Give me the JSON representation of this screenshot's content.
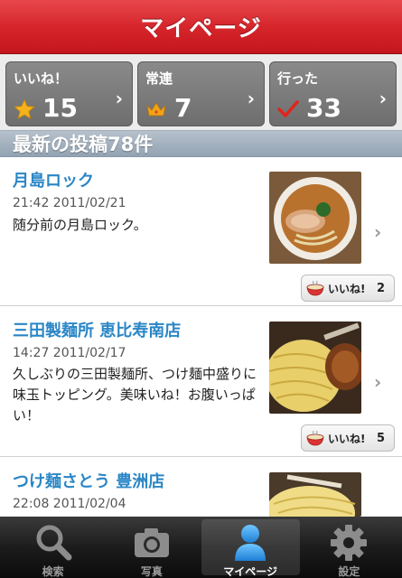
{
  "header": {
    "title": "マイページ"
  },
  "stats": [
    {
      "label": "いいね！",
      "count": "15",
      "icon": "star-icon",
      "color": "#f5b21a"
    },
    {
      "label": "常連",
      "count": "7",
      "icon": "crown-icon",
      "color": "#f0a318"
    },
    {
      "label": "行った",
      "count": "33",
      "icon": "checkmark-icon",
      "color": "#e2231a"
    }
  ],
  "section": {
    "title": "最新の投稿78件"
  },
  "posts": [
    {
      "title": "月島ロック",
      "time": "21:42 2011/02/21",
      "body": "随分前の月島ロック。",
      "like_label": "いいね!",
      "like_count": "2"
    },
    {
      "title": "三田製麺所 恵比寿南店",
      "time": "14:27 2011/02/17",
      "body": "久しぶりの三田製麺所、つけ麺中盛りに味玉トッピング。美味いね！お腹いっぱい！",
      "like_label": "いいね!",
      "like_count": "5"
    },
    {
      "title": "つけ麺さとう 豊洲店",
      "time": "22:08 2011/02/04",
      "body": "",
      "like_label": "",
      "like_count": ""
    }
  ],
  "tabs": [
    {
      "label": "検索",
      "icon": "search-icon"
    },
    {
      "label": "写真",
      "icon": "camera-icon"
    },
    {
      "label": "マイページ",
      "icon": "person-icon",
      "active": true
    },
    {
      "label": "設定",
      "icon": "gear-icon"
    }
  ],
  "colors": {
    "header_red": "#d6262c",
    "link_blue": "#2a86c6",
    "stat_gray": "#7a7a7a"
  }
}
